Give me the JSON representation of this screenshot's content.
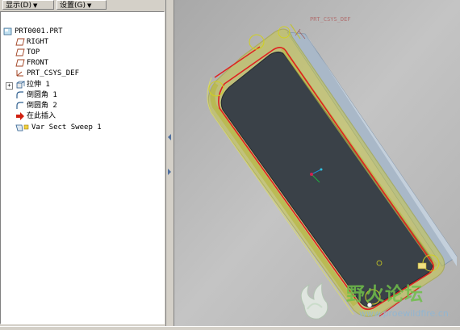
{
  "toolbar": {
    "show_label": "显示(D)",
    "settings_label": "设置(G)"
  },
  "tree": {
    "items": [
      {
        "label": "PRT0001.PRT",
        "icon": "part-icon"
      },
      {
        "label": "RIGHT",
        "icon": "datum-plane-icon"
      },
      {
        "label": "TOP",
        "icon": "datum-plane-icon"
      },
      {
        "label": "FRONT",
        "icon": "datum-plane-icon"
      },
      {
        "label": "PRT_CSYS_DEF",
        "icon": "coordinate-system-icon"
      },
      {
        "label": "拉伸 1",
        "icon": "extrude-icon"
      },
      {
        "label": "倒圆角 1",
        "icon": "round-icon"
      },
      {
        "label": "倒圆角 2",
        "icon": "round-icon"
      },
      {
        "label": "在此插入",
        "icon": "insert-here-arrow-icon"
      },
      {
        "label": "Var Sect Sweep 1",
        "icon": "var-sect-sweep-icon"
      }
    ]
  },
  "viewport": {
    "csys_label": "PRT_CSYS_DEF"
  },
  "watermark": {
    "title": "野火论坛",
    "url": "www.proewildfire.cn"
  },
  "colors": {
    "tree_bg": "#ffffff",
    "viewport_bg": "#b7b7b7",
    "selection_yellow": "#c8c84a",
    "highlight_red": "#e02020",
    "face_dark": "#3a4148",
    "face_light": "#aebccb"
  }
}
